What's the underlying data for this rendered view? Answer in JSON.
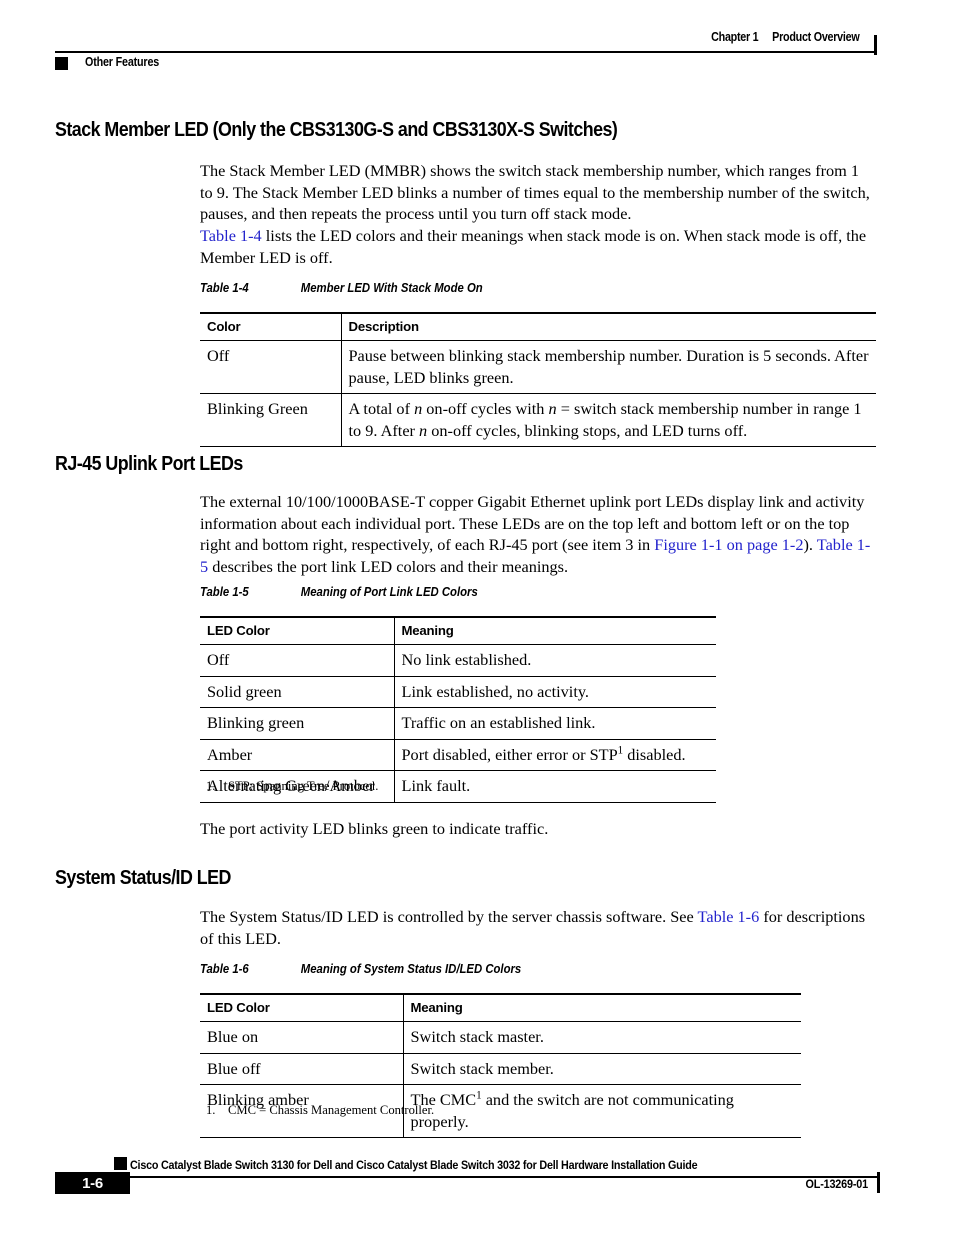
{
  "header": {
    "chapter_label": "Chapter 1",
    "chapter_title": "Product Overview",
    "section_label": "Other Features"
  },
  "sections": [
    {
      "heading": "Stack Member LED (Only the CBS3130G-S and CBS3130X-S Switches)",
      "paragraphs": [
        "The Stack Member LED (MMBR) shows the switch stack membership number, which ranges from 1 to 9. The Stack Member LED blinks a number of times equal to the membership number of the switch, pauses, and then repeats the process until you turn off stack mode.",
        "Table 1-4 lists the LED colors and their meanings when stack mode is on. When stack mode is off, the Member LED is off."
      ]
    },
    {
      "heading": "RJ-45 Uplink Port LEDs",
      "paragraphs": [
        "The external 10/100/1000BASE-T copper Gigabit Ethernet uplink port LEDs display link and activity information about each individual port. These LEDs are on the top left and bottom left or on the top right and bottom right, respectively, of each RJ-45 port (see item 3 in Figure 1-1 on page 1-2). Table 1-5 describes the port link LED colors and their meanings.",
        "The port activity LED blinks green to indicate traffic."
      ]
    },
    {
      "heading": "System Status/ID LED",
      "paragraphs": [
        "The System Status/ID LED is controlled by the server chassis software. See Table 1-6 for descriptions of this LED."
      ]
    }
  ],
  "links": {
    "table_1_4": "Table 1-4",
    "figure_1_1": "Figure 1-1 on page 1-2",
    "table_1_5": "Table 1-5",
    "table_1_6": "Table 1-6",
    "color": "#2222cc"
  },
  "table_1_4": {
    "number": "Table 1-4",
    "title": "Member LED With Stack Mode On",
    "columns": [
      "Color",
      "Description"
    ],
    "rows": [
      {
        "color": "Off",
        "description": "Pause between blinking stack membership number. Duration is 5 seconds. After pause, LED blinks green."
      },
      {
        "color": "Blinking Green",
        "description": "A total of n on-off cycles with n = switch stack membership number in range 1 to 9. After n on-off cycles, blinking stops, and LED turns off."
      }
    ]
  },
  "table_1_5": {
    "number": "Table 1-5",
    "title": "Meaning of Port Link LED Colors",
    "columns": [
      "LED Color",
      "Meaning"
    ],
    "rows": [
      {
        "color": "Off",
        "meaning": "No link established."
      },
      {
        "color": "Solid green",
        "meaning": "Link established, no activity."
      },
      {
        "color": "Blinking green",
        "meaning": "Traffic on an established link."
      },
      {
        "color": "Amber",
        "meaning": "Port disabled, either error or STP1 disabled."
      },
      {
        "color": "Alternating Green/Amber",
        "meaning": "Link fault."
      }
    ],
    "footnote_number": "1.",
    "footnote": "STP: Spanning Tree Protocol."
  },
  "table_1_6": {
    "number": "Table 1-6",
    "title": "Meaning of System Status ID/LED Colors",
    "columns": [
      "LED Color",
      "Meaning"
    ],
    "rows": [
      {
        "color": "Blue on",
        "meaning": "Switch stack master."
      },
      {
        "color": "Blue off",
        "meaning": "Switch stack member."
      },
      {
        "color": "Blinking amber",
        "meaning": "The CMC1 and the switch are not communicating properly."
      }
    ],
    "footnote_number": "1.",
    "footnote": "CMC = Chassis Management Controller."
  },
  "footer": {
    "title": "Cisco Catalyst Blade Switch 3130 for Dell and Cisco Catalyst Blade Switch 3032 for Dell Hardware Installation Guide",
    "page_number": "1-6",
    "doc_id": "OL-13269-01"
  }
}
